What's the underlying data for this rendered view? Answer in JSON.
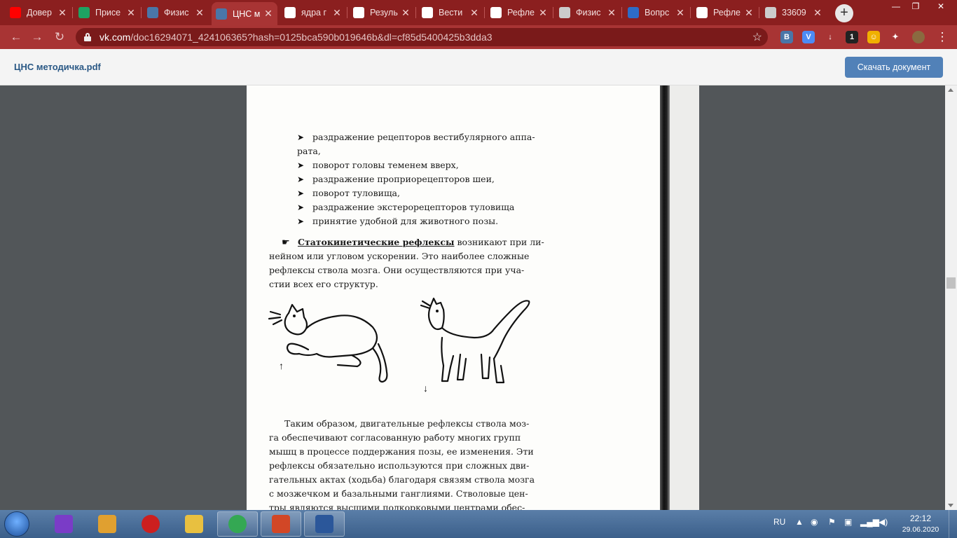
{
  "browser": {
    "tabs": [
      {
        "title": "Довер",
        "icon": "youtube-icon",
        "color": "#ff0000"
      },
      {
        "title": "Присе",
        "icon": "google-drive-icon",
        "color": "#1ea362"
      },
      {
        "title": "Физис",
        "icon": "vk-icon",
        "color": "#4a76a8"
      },
      {
        "title": "ЦНС м",
        "icon": "vk-icon",
        "color": "#4a76a8",
        "active": true
      },
      {
        "title": "ядра г",
        "icon": "google-icon",
        "color": "#ffffff"
      },
      {
        "title": "Резуль",
        "icon": "google-icon",
        "color": "#ffffff"
      },
      {
        "title": "Вести",
        "icon": "google-icon",
        "color": "#ffffff"
      },
      {
        "title": "Рефле",
        "icon": "google-icon",
        "color": "#ffffff"
      },
      {
        "title": "Физис",
        "icon": "globe-icon",
        "color": "#cccccc"
      },
      {
        "title": "Вопрс",
        "icon": "site-s-icon",
        "color": "#2e6cc7"
      },
      {
        "title": "Рефле",
        "icon": "google-icon",
        "color": "#ffffff"
      },
      {
        "title": "33609",
        "icon": "globe-icon",
        "color": "#cccccc"
      }
    ],
    "new_tab": "+",
    "url_host": "vk.com",
    "url_path": "/doc16294071_424106365?hash=0125bca590b019646b&dl=cf85d5400425b3dda3",
    "extensions": [
      {
        "label": "B",
        "color": "#4a76a8"
      },
      {
        "label": "V",
        "color": "#4c8bf5"
      },
      {
        "label": "↓",
        "color": "#a83434"
      },
      {
        "label": "1",
        "color": "#222222"
      },
      {
        "label": "☺",
        "color": "#f0b000"
      },
      {
        "label": "✦",
        "color": "#a83434"
      }
    ]
  },
  "doc": {
    "name": "ЦНС методичка.pdf",
    "download_label": "Скачать документ"
  },
  "content": {
    "bullets": [
      "раздражение рецепторов вестибулярного аппа-",
      "рата,",
      "поворот головы теменем вверх,",
      "раздражение проприорецепторов шеи,",
      "поворот туловища,",
      "раздражение экстерорецепторов туловища",
      "принятие удобной для животного позы."
    ],
    "statokinetic_term": "Статокинетические рефлексы",
    "statokinetic_lines": [
      "возникают при ли-",
      "нейном или угловом ускорении. Это наиболее сложные",
      "рефлексы ствола мозга. Они осуществляются при уча-",
      "стии всех его структур."
    ],
    "paragraph2": [
      "Таким образом, двигательные рефлексы ствола моз-",
      "га обеспечивают согласованную работу многих групп",
      "мышц в процессе поддержания позы, ее изменения. Эти",
      "рефлексы обязательно используются при сложных дви-",
      "гательных актах (ходьба) благодаря связям ствола мозга",
      "с мозжечком и базальными ганглиями. Стволовые цен-",
      "тры являются высшими подкорковыми центрами обес-"
    ],
    "arrow_up": "↑",
    "arrow_down": "↓"
  },
  "taskbar": {
    "apps": [
      {
        "name": "start-orb"
      },
      {
        "name": "media-player",
        "color": "#7a3cc7"
      },
      {
        "name": "paint",
        "color": "#e0a030"
      },
      {
        "name": "opera",
        "color": "#cc1f1f"
      },
      {
        "name": "explorer",
        "color": "#e8c040"
      },
      {
        "name": "chrome",
        "color": "#34a853",
        "open": true
      },
      {
        "name": "powerpoint",
        "color": "#d24726",
        "open": true
      },
      {
        "name": "word",
        "color": "#2b579a",
        "open": true
      }
    ],
    "language": "RU",
    "time": "22:12",
    "date": "29.06.2020"
  }
}
